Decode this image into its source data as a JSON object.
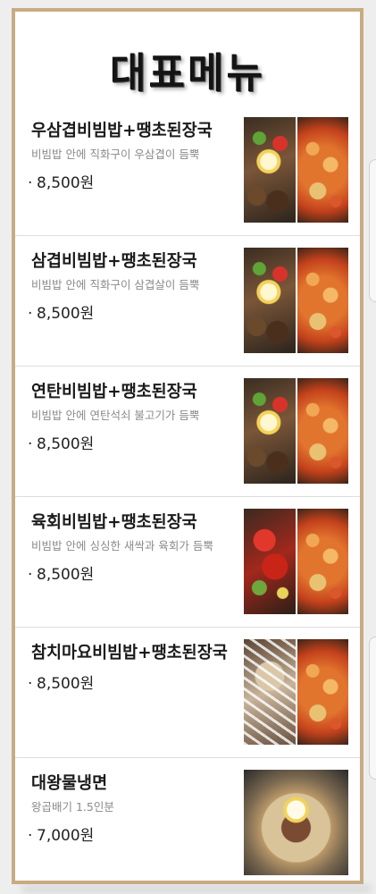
{
  "title": "대표메뉴",
  "menu": [
    {
      "name": "우삼겹비빔밥+땡초된장국",
      "description": "비빔밥 안에 직화구이 우삼겹이 듬뿍",
      "bullet": "·",
      "price": "8,500원"
    },
    {
      "name": "삼겹비빔밥+땡초된장국",
      "description": "비빔밥 안에 직화구이 삼겹살이 듬뿍",
      "bullet": "·",
      "price": "8,500원"
    },
    {
      "name": "연탄비빔밥+땡초된장국",
      "description": "비빔밥 안에 연탄석쇠 불고기가 듬뿍",
      "bullet": "·",
      "price": "8,500원"
    },
    {
      "name": "육회비빔밥+땡초된장국",
      "description": "비빔밥 안에 싱싱한 새싹과 육회가 듬뿍",
      "bullet": "·",
      "price": "8,500원"
    },
    {
      "name": "참치마요비빔밥+땡초된장국",
      "description": "",
      "bullet": "·",
      "price": "8,500원"
    },
    {
      "name": "대왕물냉면",
      "description": "왕곱배기 1.5인분",
      "bullet": "·",
      "price": "7,000원"
    }
  ],
  "colors": {
    "frame_border": "#c8ab82",
    "title_text": "#141414",
    "name_text": "#1a1a1a",
    "description_text": "#8a8a8a"
  }
}
